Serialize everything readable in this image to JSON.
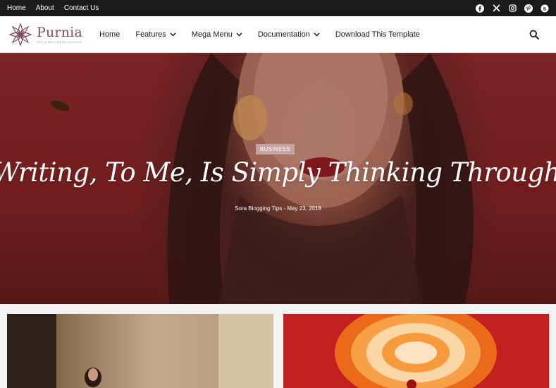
{
  "topbar": {
    "links": [
      "Home",
      "About",
      "Contact Us"
    ],
    "social": [
      "facebook-icon",
      "x-icon",
      "instagram-icon",
      "pinterest-icon",
      "skype-icon"
    ]
  },
  "header": {
    "logo_name": "Purnia",
    "logo_tagline": "SPA & WELLNESS CENTER",
    "nav": [
      {
        "label": "Home",
        "has_dropdown": false
      },
      {
        "label": "Features",
        "has_dropdown": true
      },
      {
        "label": "Mega Menu",
        "has_dropdown": true
      },
      {
        "label": "Documentation",
        "has_dropdown": true
      },
      {
        "label": "Download This Template",
        "has_dropdown": false
      }
    ],
    "search_icon": "search-icon"
  },
  "hero": {
    "category": "BUSINESS",
    "title": "Writing, To Me, Is Simply Thinking Through My Fingers",
    "meta": "Sora Blogging Tips - May 23, 2018"
  },
  "colors": {
    "topbar_bg": "#1a1a1a",
    "brand": "#7a4b5c",
    "badge": "#c6a4a4"
  }
}
